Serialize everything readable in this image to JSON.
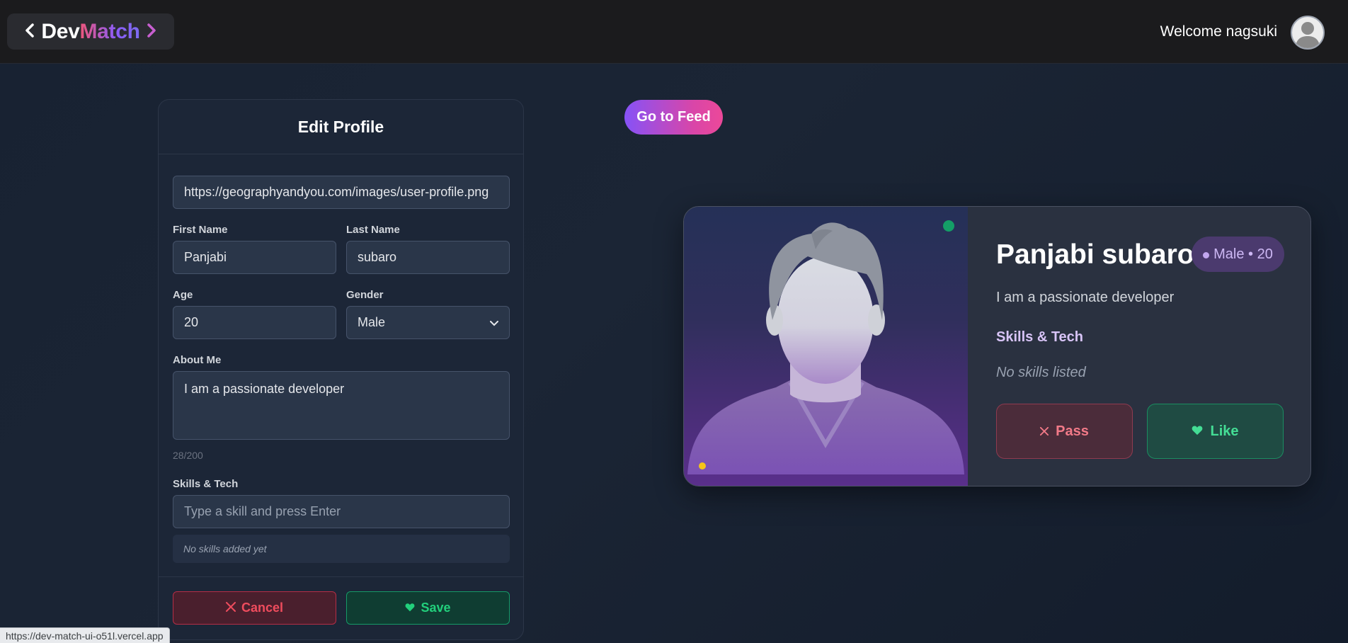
{
  "navbar": {
    "brand_dev": "Dev",
    "brand_match": "Match",
    "welcome": "Welcome nagsuki"
  },
  "edit_profile": {
    "title": "Edit Profile",
    "photo_url_value": "https://geographyandyou.com/images/user-profile.png",
    "first_name_label": "First Name",
    "first_name_value": "Panjabi",
    "last_name_label": "Last Name",
    "last_name_value": "subaro",
    "age_label": "Age",
    "age_value": "20",
    "gender_label": "Gender",
    "gender_value": "Male",
    "about_label": "About Me",
    "about_value": "I am a passionate developer",
    "char_count": "28/200",
    "skills_label": "Skills & Tech",
    "skills_placeholder": "Type a skill and press Enter",
    "no_skills": "No skills added yet",
    "cancel_label": "Cancel",
    "save_label": "Save"
  },
  "feed_button": "Go to Feed",
  "preview": {
    "name": "Panjabi subaro",
    "badge": "Male • 20",
    "bio": "I am a passionate developer",
    "skills_title": "Skills & Tech",
    "skills_empty": "No skills listed",
    "pass_label": "Pass",
    "like_label": "Like"
  },
  "status_url": "https://dev-match-ui-o51l.vercel.app",
  "colors": {
    "accent_purple": "#8652f7",
    "accent_pink": "#ec4899",
    "cancel_red": "#ef4c5d",
    "save_green": "#22d07c",
    "online_green": "#149e67"
  },
  "icons": {
    "brand_left": "chevron-left-icon",
    "brand_right": "chevron-right-icon",
    "cancel": "x-icon",
    "save": "heart-icon",
    "pass": "x-icon",
    "like": "heart-icon",
    "gender_select": "chevron-down-icon"
  }
}
